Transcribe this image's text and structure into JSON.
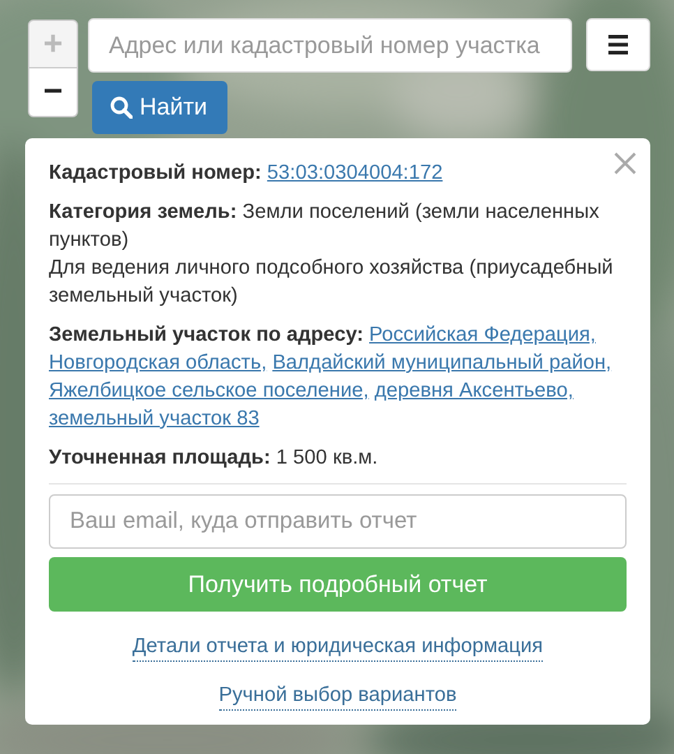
{
  "map_controls": {
    "zoom_in": {
      "label": "+",
      "disabled": true
    },
    "zoom_out": {
      "label": "−",
      "disabled": false
    }
  },
  "search": {
    "placeholder": "Адрес или кадастровый номер участка",
    "button": "Найти"
  },
  "info_panel": {
    "fields": [
      {
        "kind": "link",
        "label": "Кадастровый номер:",
        "value": "53:03:0304004:172"
      },
      {
        "kind": "text",
        "text": "**Категория земель:** Земли поселений (земли населенных пунктов)"
      },
      {
        "kind": "note",
        "value": "Для ведения личного подсобного хозяйства (приусадебный земельный участок)"
      },
      {
        "kind": "links",
        "label": "Земельный участок по адресу:",
        "parts": [
          "Российская Федерация,",
          "Новгородская область,",
          "Валдайский муниципальный район,",
          "Яжелбицкое сельское поселение,",
          "деревня Аксентьево,",
          "земельный участок 83"
        ]
      },
      {
        "kind": "text",
        "text": "**Уточненная площадь:** 1 500 кв.м."
      }
    ],
    "email": {
      "placeholder": "Ваш email, куда отправить отчет"
    },
    "submit": "Получить подробный отчет",
    "links": [
      "Детали отчета и юридическая информация",
      "Ручной выбор вариантов"
    ]
  }
}
